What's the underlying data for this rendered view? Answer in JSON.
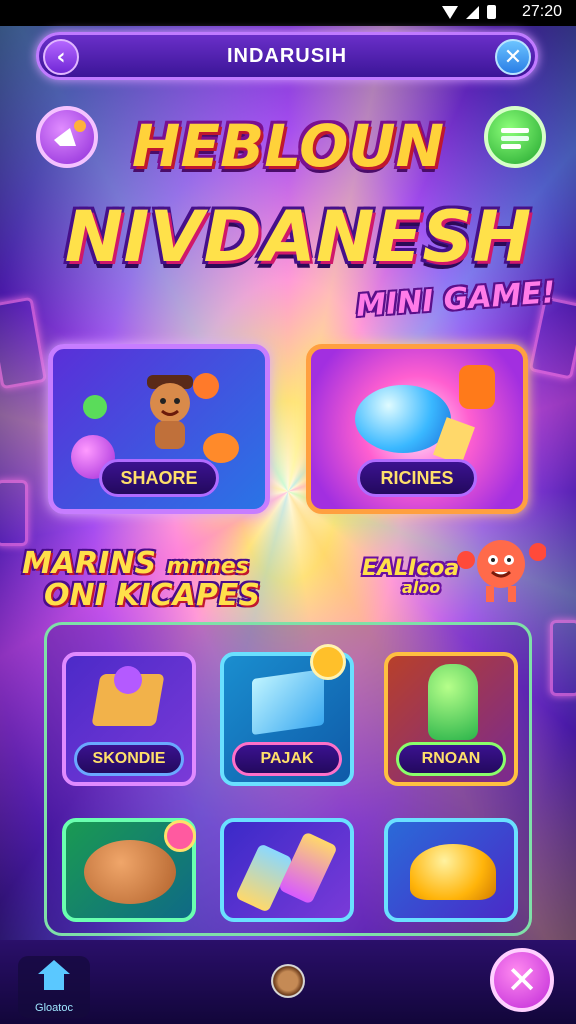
{
  "status_bar": {
    "time": "27:20"
  },
  "top_bar": {
    "title": "INDARUSIH",
    "back_icon": "back-arrow-icon",
    "close_icon": "close-icon"
  },
  "hero": {
    "title_line1": "HEBLOUN",
    "title_line2": "NIVDANESH",
    "subtitle": "MINI GAME!"
  },
  "featured": [
    {
      "label": "SHAORE",
      "icon": "bear-character-icon"
    },
    {
      "label": "RICINES",
      "icon": "gem-orb-icon"
    }
  ],
  "section": {
    "title_line1": "MARINS",
    "title_line1_small": "mnnes",
    "title_line2": "ONI KICAPES",
    "side_label_line1": "EALIcoa",
    "side_label_line2": "aloo"
  },
  "games": [
    {
      "label": "SKONDIE",
      "icon": "cake-box-icon"
    },
    {
      "label": "PAJAK",
      "icon": "blue-card-icon"
    },
    {
      "label": "RNOAN",
      "icon": "green-slime-icon"
    },
    {
      "label": "",
      "icon": "cookie-character-icon"
    },
    {
      "label": "",
      "icon": "candy-sticks-icon"
    },
    {
      "label": "",
      "icon": "golden-dome-icon"
    }
  ],
  "bottom_bar": {
    "home_label": "Gloatoc",
    "exit_icon": "exit-x-icon"
  },
  "colors": {
    "accent_purple": "#7a2fe0",
    "accent_gold": "#ffe04a",
    "accent_pink": "#ff6fd8",
    "accent_green": "#6affb0"
  }
}
